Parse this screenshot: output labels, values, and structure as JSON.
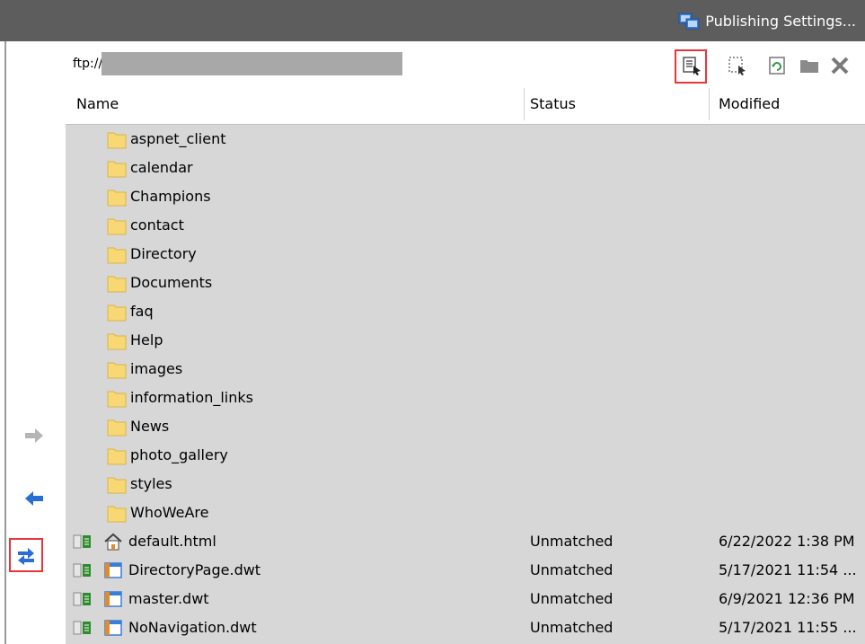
{
  "toolbar": {
    "publishing_settings_label": "Publishing Settings...",
    "address_prefix": "ftp://"
  },
  "table": {
    "headers": {
      "name": "Name",
      "status": "Status",
      "modified": "Modified"
    }
  },
  "folders": [
    "aspnet_client",
    "calendar",
    "Champions",
    "contact",
    "Directory",
    "Documents",
    "faq",
    "Help",
    "images",
    "information_links",
    "News",
    "photo_gallery",
    "styles",
    "WhoWeAre"
  ],
  "files": [
    {
      "name": "default.html",
      "status": "Unmatched",
      "modified": "6/22/2022 1:38 PM",
      "icon": "home-page-icon"
    },
    {
      "name": "DirectoryPage.dwt",
      "status": "Unmatched",
      "modified": "5/17/2021 11:54 ...",
      "icon": "template-icon"
    },
    {
      "name": "master.dwt",
      "status": "Unmatched",
      "modified": "6/9/2021 12:36 PM",
      "icon": "template-icon"
    },
    {
      "name": "NoNavigation.dwt",
      "status": "Unmatched",
      "modified": "5/17/2021 11:55 ...",
      "icon": "template-icon"
    }
  ],
  "colors": {
    "topbar": "#5d5d5d",
    "folder": "#f8d775",
    "highlight": "#e8353b",
    "arrow_blue": "#2a6dd4",
    "list_bg": "#d7d7d7"
  }
}
